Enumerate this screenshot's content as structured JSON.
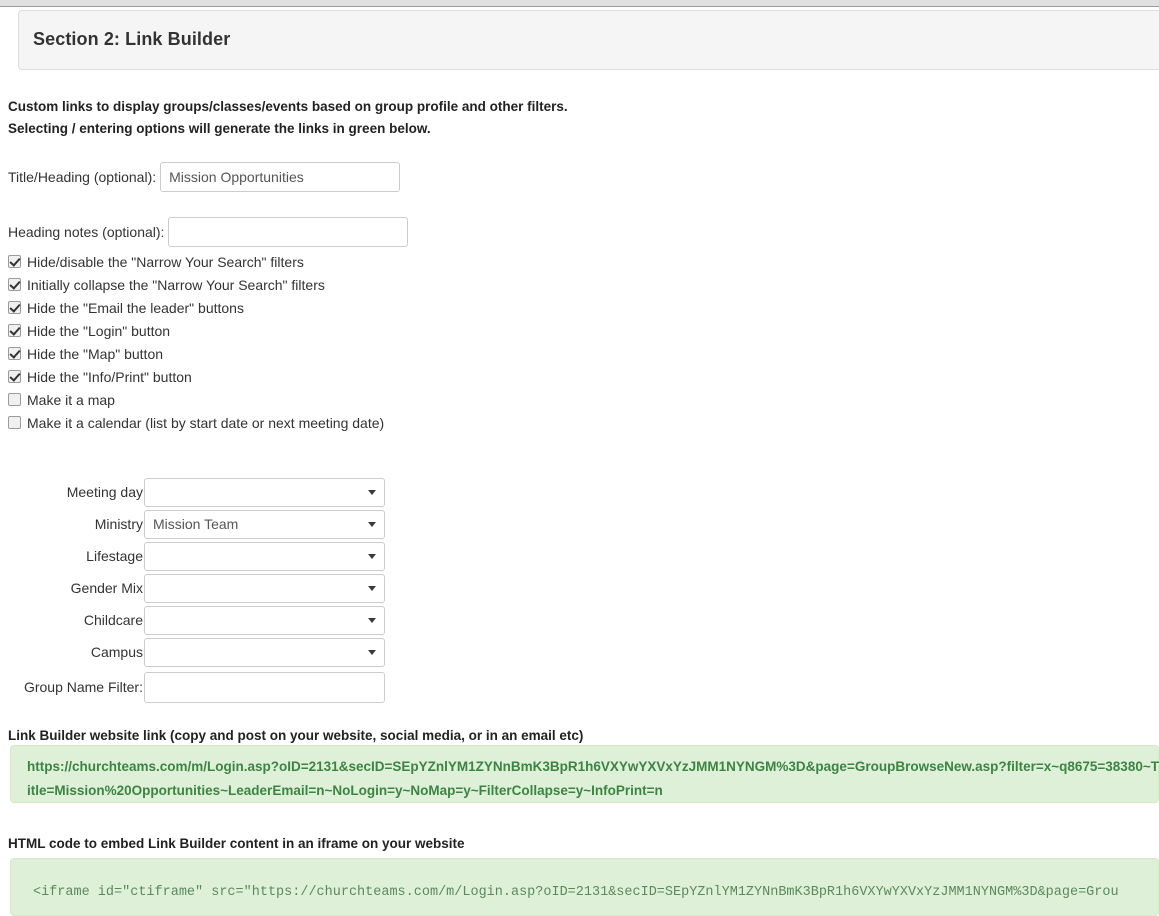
{
  "panel": {
    "title": "Section 2: Link Builder"
  },
  "intro": {
    "line1": "Custom links to display groups/classes/events based on group profile and other filters.",
    "line2": "Selecting / entering options will generate the links in green below."
  },
  "fields": {
    "title_heading": {
      "label": "Title/Heading (optional):",
      "value": "Mission Opportunities",
      "placeholder": "Mission Opportunities"
    },
    "heading_notes": {
      "label": "Heading notes (optional):",
      "value": "",
      "placeholder": ""
    }
  },
  "checkboxes": [
    {
      "label": "Hide/disable the \"Narrow Your Search\" filters",
      "checked": true
    },
    {
      "label": "Initially collapse the \"Narrow Your Search\" filters",
      "checked": true
    },
    {
      "label": "Hide the \"Email the leader\" buttons",
      "checked": true
    },
    {
      "label": "Hide the \"Login\" button",
      "checked": true
    },
    {
      "label": "Hide the \"Map\" button",
      "checked": true
    },
    {
      "label": "Hide the \"Info/Print\" button",
      "checked": true
    },
    {
      "label": "Make it a map",
      "checked": false
    },
    {
      "label": "Make it a calendar (list by start date or next meeting date)",
      "checked": false
    }
  ],
  "selects": [
    {
      "label": "Meeting day",
      "value": ""
    },
    {
      "label": "Ministry",
      "value": "Mission Team"
    },
    {
      "label": "Lifestage",
      "value": ""
    },
    {
      "label": "Gender Mix",
      "value": ""
    },
    {
      "label": "Childcare",
      "value": ""
    },
    {
      "label": "Campus",
      "value": ""
    }
  ],
  "group_name_filter": {
    "label": "Group Name Filter:",
    "value": "",
    "placeholder": ""
  },
  "website_link": {
    "caption": "Link Builder website link (copy and post on your website, social media, or in an email etc)",
    "url": "https://churchteams.com/m/Login.asp?oID=2131&secID=SEpYZnlYM1ZYNnBmK3BpR1h6VXYwYXVxYzJMM1NYNGM%3D&page=GroupBrowseNew.asp?filter=x~q8675=38380~Title=Mission%20Opportunities~LeaderEmail=n~NoLogin=y~NoMap=y~FilterCollapse=y~InfoPrint=n"
  },
  "iframe_code": {
    "caption": "HTML code to embed Link Builder content in an iframe on your website",
    "code": "<iframe id=\"ctiframe\" src=\"https://churchteams.com/m/Login.asp?oID=2131&secID=SEpYZnlYM1ZYNnBmK3BpR1h6VXYwYXVxYzJMM1NYNGM%3D&page=Grou"
  },
  "colors": {
    "panel_bg": "#f5f5f5",
    "green_bg": "#dff0d8",
    "green_border": "#d6e9c6",
    "green_text": "#3c8442",
    "code_text": "#5a8a5c"
  }
}
